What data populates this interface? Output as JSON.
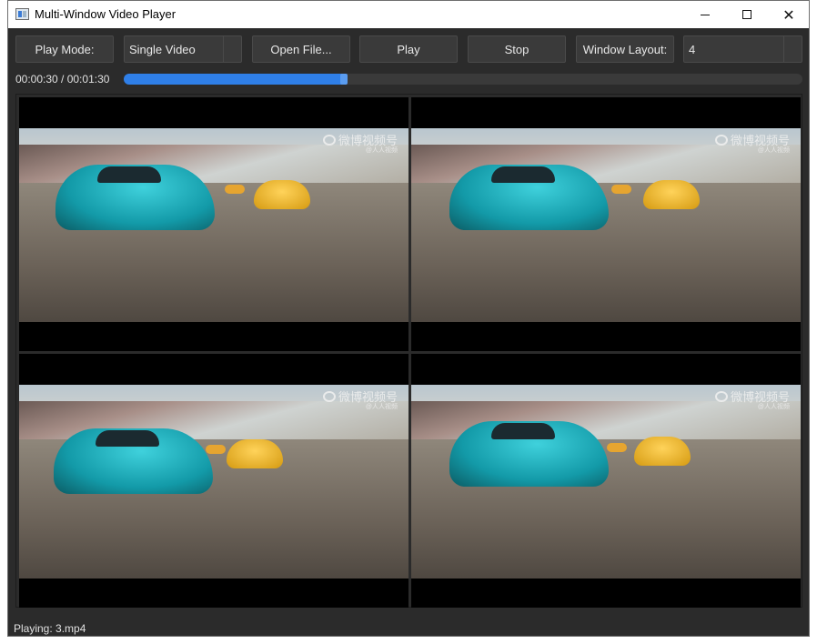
{
  "window": {
    "title": "Multi-Window Video Player",
    "icon": "app-icon",
    "controls": [
      "minimize-icon",
      "maximize-icon",
      "close-icon"
    ]
  },
  "toolbar": {
    "play_mode_label": "Play Mode:",
    "play_mode_value": "Single Video",
    "open_file_label": "Open File...",
    "play_label": "Play",
    "stop_label": "Stop",
    "window_layout_label": "Window Layout:",
    "window_layout_value": "4"
  },
  "playback": {
    "time_text": "00:00:30 / 00:01:30",
    "progress_fraction": 0.33,
    "accent_color": "#2f7fe8"
  },
  "video_panes": [
    {
      "watermark": "微博视频号",
      "watermark_sub": "@人人视频"
    },
    {
      "watermark": "微博视频号",
      "watermark_sub": "@人人视频"
    },
    {
      "watermark": "微博视频号",
      "watermark_sub": "@人人视频"
    },
    {
      "watermark": "微博视频号",
      "watermark_sub": "@人人视频"
    }
  ],
  "status": {
    "text": "Playing: 3.mp4"
  }
}
